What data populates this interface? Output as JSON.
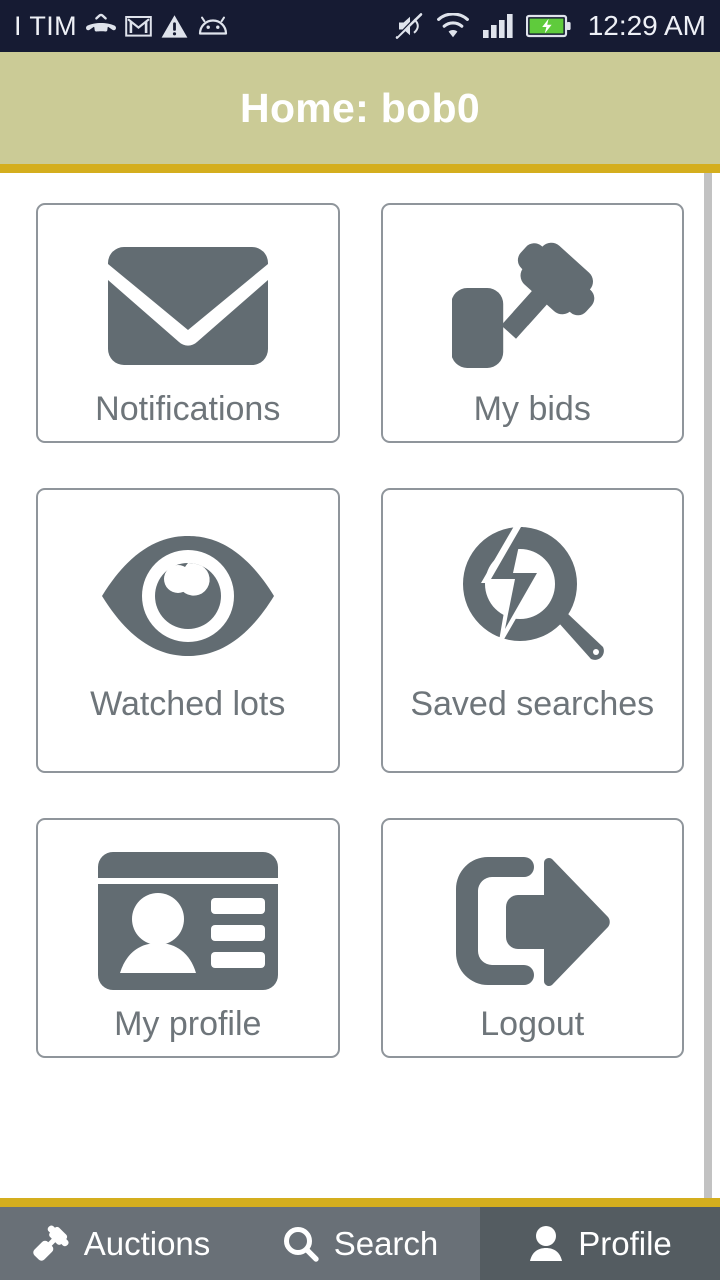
{
  "status_bar": {
    "carrier": "I TIM",
    "time": "12:29 AM",
    "left_icons": [
      "missed-call-icon",
      "gmail-icon",
      "warning-triangle-icon",
      "android-robot-icon"
    ],
    "right_icons": [
      "mute-icon",
      "wifi-icon",
      "cellular-signal-icon",
      "battery-charging-icon"
    ],
    "background_color": "#161b33",
    "text_color": "#eef0f6",
    "battery_color": "#5fcb3c"
  },
  "header": {
    "title": "Home: bob0",
    "background_color": "#cbcb96",
    "rule_color": "#d4ae1e",
    "text_color": "#ffffff"
  },
  "content": {
    "background_color": "#ffffff",
    "tile_border_color": "#8f959b",
    "icon_color": "#626c72",
    "label_color": "#6e757a",
    "tiles": [
      {
        "label": "Notifications",
        "icon": "envelope-icon"
      },
      {
        "label": "My bids",
        "icon": "gavel-icon"
      },
      {
        "label": "Watched lots",
        "icon": "eye-icon"
      },
      {
        "label": "Saved searches",
        "icon": "magnifier-lightning-icon"
      },
      {
        "label": "My profile",
        "icon": "id-card-icon"
      },
      {
        "label": "Logout",
        "icon": "logout-arrow-icon"
      }
    ]
  },
  "scrollbar": {
    "color": "#c2c2c2"
  },
  "bottom_nav": {
    "rule_color": "#d4ae1e",
    "inactive_color": "#697077",
    "active_color": "#545c61",
    "text_color": "#ffffff",
    "items": [
      {
        "label": "Auctions",
        "icon": "gavel-icon",
        "active": false
      },
      {
        "label": "Search",
        "icon": "search-icon",
        "active": false
      },
      {
        "label": "Profile",
        "icon": "person-icon",
        "active": true
      }
    ]
  }
}
